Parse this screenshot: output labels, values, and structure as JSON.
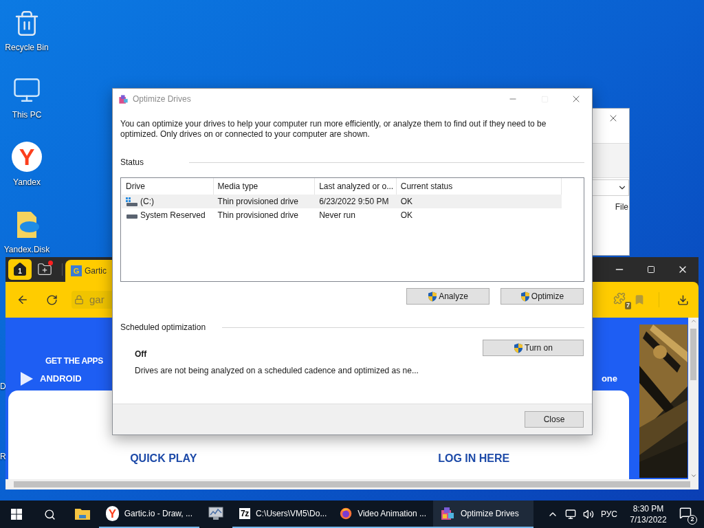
{
  "desktop": {
    "icons": [
      {
        "kind": "recycle",
        "label": "Recycle Bin"
      },
      {
        "kind": "pc",
        "label": "This PC"
      },
      {
        "kind": "yandex",
        "label": "Yandex",
        "logo_text": "Y"
      },
      {
        "kind": "disk",
        "label": "Yandex.Disk"
      }
    ],
    "cut_labels": [
      "D",
      "R"
    ]
  },
  "back_window": {
    "menu_text": "File"
  },
  "browser": {
    "home_count": "1",
    "favicon_text": "G",
    "tab_title": "Gartic",
    "address": "gar",
    "extensions_badge": "7",
    "page": {
      "apps_heading": "GET THE APPS",
      "android": "ANDROID",
      "cut_text": "one",
      "quick_play": "QUICK PLAY",
      "login": "LOG IN HERE"
    }
  },
  "dialog": {
    "title": "Optimize Drives",
    "maximize_disabled": true,
    "intro": "You can optimize your drives to help your computer run more efficiently, or analyze them to find out if they need to be optimized. Only drives on or connected to your computer are shown.",
    "status_label": "Status",
    "columns": [
      "Drive",
      "Media type",
      "Last analyzed or o...",
      "Current status"
    ],
    "drives": [
      {
        "kind": "system",
        "name": "(C:)",
        "media_type": "Thin provisioned drive",
        "last_analyzed": "6/23/2022 9:50 PM",
        "status": "OK",
        "selected": true
      },
      {
        "kind": "plain",
        "name": "System Reserved",
        "media_type": "Thin provisioned drive",
        "last_analyzed": "Never run",
        "status": "OK",
        "selected": false
      }
    ],
    "actions": [
      "Analyze",
      "Optimize"
    ],
    "schedule": {
      "label": "Scheduled optimization",
      "state": "Off",
      "description": "Drives are not being analyzed on a scheduled cadence and optimized as ne...",
      "button": "Turn on"
    },
    "close": "Close"
  },
  "taskbar": {
    "apps": [
      {
        "kind": "explorer",
        "running": false,
        "selected": false
      },
      {
        "kind": "yandex",
        "logo_text": "Y",
        "label": "Gartic.io - Draw, ...",
        "running": true,
        "selected": false
      },
      {
        "kind": "perfmon",
        "running": false,
        "selected": false
      },
      {
        "kind": "sevenzip",
        "icon_text": "7z",
        "label": "C:\\Users\\VM5\\Do...",
        "running": true,
        "selected": false
      },
      {
        "kind": "firefox",
        "label": "Video Animation ...",
        "running": true,
        "selected": false
      },
      {
        "kind": "defrag",
        "label": "Optimize Drives",
        "running": true,
        "selected": true
      }
    ],
    "language": "РУС",
    "time": "8:30 PM",
    "date": "7/13/2022",
    "notifications": "2"
  }
}
